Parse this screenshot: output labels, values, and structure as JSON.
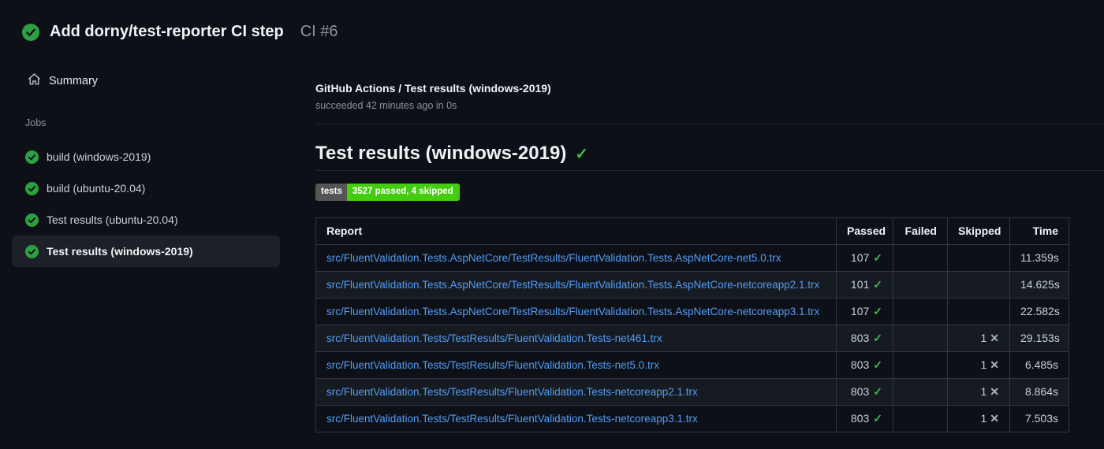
{
  "colors": {
    "background": "#0d1117",
    "status_green": "#2ea043",
    "check_green": "#3fb950",
    "link_blue": "#539bf5",
    "badge_label_bg": "#555555",
    "badge_value_bg": "#44cc11",
    "selected_item_bg": "#1c2128"
  },
  "run_header": {
    "status_icon": "check-circle-icon",
    "title": "Add dorny/test-reporter CI step",
    "run_number": "CI #6"
  },
  "sidebar": {
    "summary_icon": "home-icon",
    "summary_label": "Summary",
    "jobs_section_label": "Jobs",
    "jobs": [
      {
        "label": "build (windows-2019)",
        "status": "success",
        "selected": false
      },
      {
        "label": "build (ubuntu-20.04)",
        "status": "success",
        "selected": false
      },
      {
        "label": "Test results (ubuntu-20.04)",
        "status": "success",
        "selected": false
      },
      {
        "label": "Test results (windows-2019)",
        "status": "success",
        "selected": true
      }
    ]
  },
  "job_header": {
    "title": "GitHub Actions / Test results (windows-2019)",
    "subtitle": "succeeded 42 minutes ago in 0s"
  },
  "report_section": {
    "heading": "Test results (windows-2019)",
    "heading_check": "✓",
    "badge": {
      "label": "tests",
      "value": "3527 passed, 4 skipped"
    },
    "table": {
      "headers": [
        "Report",
        "Passed",
        "Failed",
        "Skipped",
        "Time"
      ],
      "rows": [
        {
          "report": "src/FluentValidation.Tests.AspNetCore/TestResults/FluentValidation.Tests.AspNetCore-net5.0.trx",
          "passed": "107",
          "passed_check": "✓",
          "failed": "",
          "skipped": "",
          "skipped_cross": "",
          "time": "11.359s"
        },
        {
          "report": "src/FluentValidation.Tests.AspNetCore/TestResults/FluentValidation.Tests.AspNetCore-netcoreapp2.1.trx",
          "passed": "101",
          "passed_check": "✓",
          "failed": "",
          "skipped": "",
          "skipped_cross": "",
          "time": "14.625s"
        },
        {
          "report": "src/FluentValidation.Tests.AspNetCore/TestResults/FluentValidation.Tests.AspNetCore-netcoreapp3.1.trx",
          "passed": "107",
          "passed_check": "✓",
          "failed": "",
          "skipped": "",
          "skipped_cross": "",
          "time": "22.582s"
        },
        {
          "report": "src/FluentValidation.Tests/TestResults/FluentValidation.Tests-net461.trx",
          "passed": "803",
          "passed_check": "✓",
          "failed": "",
          "skipped": "1",
          "skipped_cross": "✕",
          "time": "29.153s"
        },
        {
          "report": "src/FluentValidation.Tests/TestResults/FluentValidation.Tests-net5.0.trx",
          "passed": "803",
          "passed_check": "✓",
          "failed": "",
          "skipped": "1",
          "skipped_cross": "✕",
          "time": "6.485s"
        },
        {
          "report": "src/FluentValidation.Tests/TestResults/FluentValidation.Tests-netcoreapp2.1.trx",
          "passed": "803",
          "passed_check": "✓",
          "failed": "",
          "skipped": "1",
          "skipped_cross": "✕",
          "time": "8.864s"
        },
        {
          "report": "src/FluentValidation.Tests/TestResults/FluentValidation.Tests-netcoreapp3.1.trx",
          "passed": "803",
          "passed_check": "✓",
          "failed": "",
          "skipped": "1",
          "skipped_cross": "✕",
          "time": "7.503s"
        }
      ]
    }
  }
}
